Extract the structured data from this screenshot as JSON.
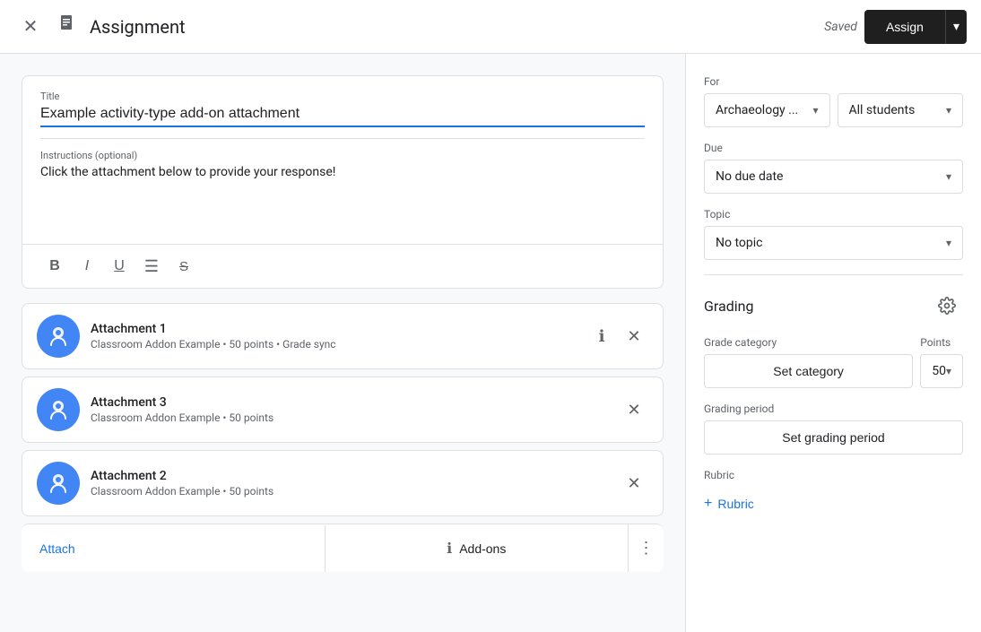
{
  "header": {
    "title": "Assignment",
    "saved_text": "Saved",
    "assign_label": "Assign",
    "close_icon": "✕",
    "doc_icon": "📋",
    "chevron_icon": "▾"
  },
  "form": {
    "title_label": "Title",
    "title_value": "Example activity-type add-on attachment",
    "instructions_label": "Instructions (optional)",
    "instructions_value": "Click the attachment below to provide your response!",
    "toolbar": {
      "bold": "B",
      "italic": "I",
      "underline": "U",
      "list": "≡",
      "strikethrough": "S̶"
    }
  },
  "attachments": [
    {
      "name": "Attachment 1",
      "meta": "Classroom Addon Example • 50 points • Grade sync"
    },
    {
      "name": "Attachment 3",
      "meta": "Classroom Addon Example • 50 points"
    },
    {
      "name": "Attachment 2",
      "meta": "Classroom Addon Example • 50 points"
    }
  ],
  "bottom_toolbar": {
    "attach_label": "Attach",
    "addons_label": "Add-ons",
    "info_icon": "ℹ",
    "more_icon": "⋮"
  },
  "right_panel": {
    "for_label": "For",
    "class_value": "Archaeology ...",
    "students_value": "All students",
    "due_label": "Due",
    "due_value": "No due date",
    "topic_label": "Topic",
    "topic_value": "No topic",
    "grading_label": "Grading",
    "grade_category_label": "Grade category",
    "set_category_label": "Set category",
    "points_label": "Points",
    "points_value": "50",
    "grading_period_label": "Grading period",
    "set_grading_period_label": "Set grading period",
    "rubric_label": "Rubric",
    "add_rubric_label": "Rubric",
    "chevron": "▾",
    "plus_icon": "+"
  }
}
